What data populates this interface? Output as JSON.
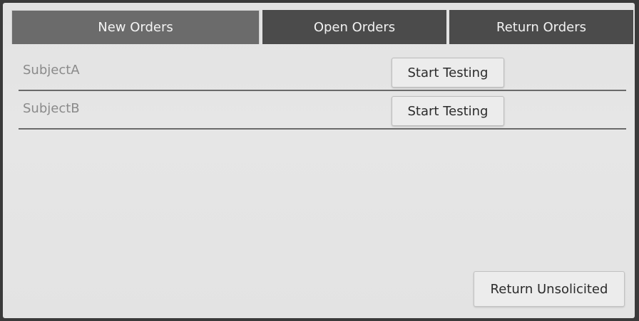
{
  "tabs": [
    {
      "label": "New Orders",
      "active": true
    },
    {
      "label": "Open Orders",
      "active": false
    },
    {
      "label": "Return Orders",
      "active": false
    }
  ],
  "orders": [
    {
      "subject": "SubjectA",
      "action_label": "Start Testing"
    },
    {
      "subject": "SubjectB",
      "action_label": "Start Testing"
    }
  ],
  "footer": {
    "return_unsolicited_label": "Return Unsolicited"
  },
  "colors": {
    "tab_bg": "#4b4b4b",
    "tab_active_bg": "#6b6b6b",
    "content_bg": "#e4e4e4",
    "row_divider": "#6a6a6a",
    "subject_text": "#8a8a8a"
  }
}
